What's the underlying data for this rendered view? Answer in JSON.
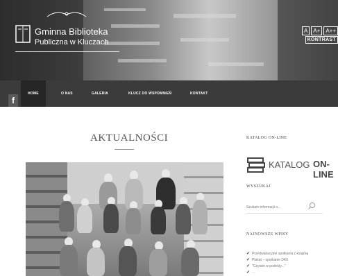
{
  "header": {
    "logo_line1": "Gminna Biblioteka",
    "logo_line2": "Publiczna w Kluczach",
    "font_buttons": [
      "A",
      "A+",
      "A++"
    ],
    "contrast_label": "KONTRAST"
  },
  "nav": {
    "facebook_icon": "f",
    "items": [
      "HOME",
      "O NAS",
      "GALERIA",
      "KLUCZ DO WSPOMNIEŃ",
      "KONTAKT"
    ]
  },
  "main": {
    "title": "AKTUALNOŚCI"
  },
  "sidebar": {
    "catalog_heading": "KATALOG ON-LINE",
    "catalog_logo_text1": "KATALOG",
    "catalog_logo_text2": "ON-LINE",
    "search_heading": "WYSZUKAJ",
    "search_placeholder": "Szukam informacji o...",
    "posts_heading": "NAJNOWSZE WPISY",
    "posts": [
      "Przedwakacyjne spotkania z książką",
      "Plakat – spotkanie DKK",
      "\"Czytam w podróży...\"",
      "..."
    ]
  },
  "colors": {
    "nav_bg": "#3b3b3b",
    "nav_active_bg": "#262626",
    "text_dark": "#444444"
  }
}
